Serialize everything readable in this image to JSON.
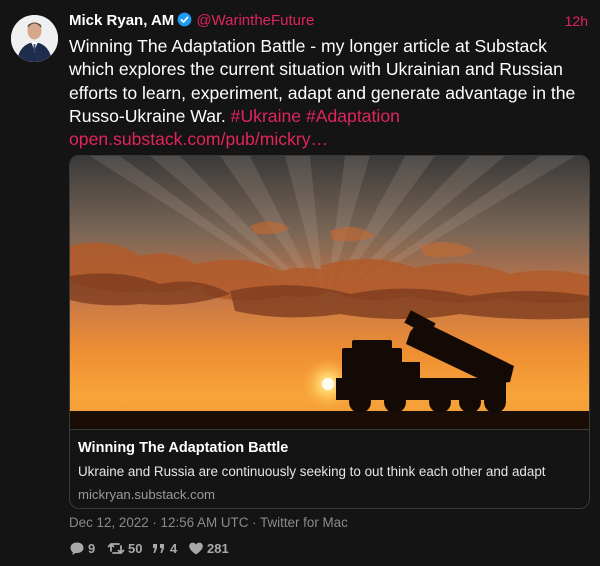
{
  "tweet": {
    "author": {
      "name": "Mick Ryan, AM",
      "handle": "@WarintheFuture",
      "verified": true
    },
    "time": "12h",
    "text_main": "Winning The Adaptation Battle - my longer article at Substack which explores the current situation with Ukrainian and Russian efforts to learn, experiment, adapt and generate advantage in the Russo-Ukraine War.",
    "hashtag_1": "#Ukraine",
    "hashtag_2": "#Adaptation",
    "link": "open.substack.com/pub/mickry…",
    "card": {
      "title": "Winning The Adaptation Battle",
      "description": "Ukraine and Russia are continuously seeking to out think each other and adapt",
      "domain": "mickryan.substack.com"
    },
    "meta": "Dec 12, 2022 · 12:56 AM UTC · Twitter for Mac",
    "stats": {
      "replies": "9",
      "retweets": "50",
      "quotes": "4",
      "likes": "281"
    }
  },
  "colors": {
    "accent": "#e0245e",
    "verified": "#1d9bf0",
    "background": "#141414"
  }
}
